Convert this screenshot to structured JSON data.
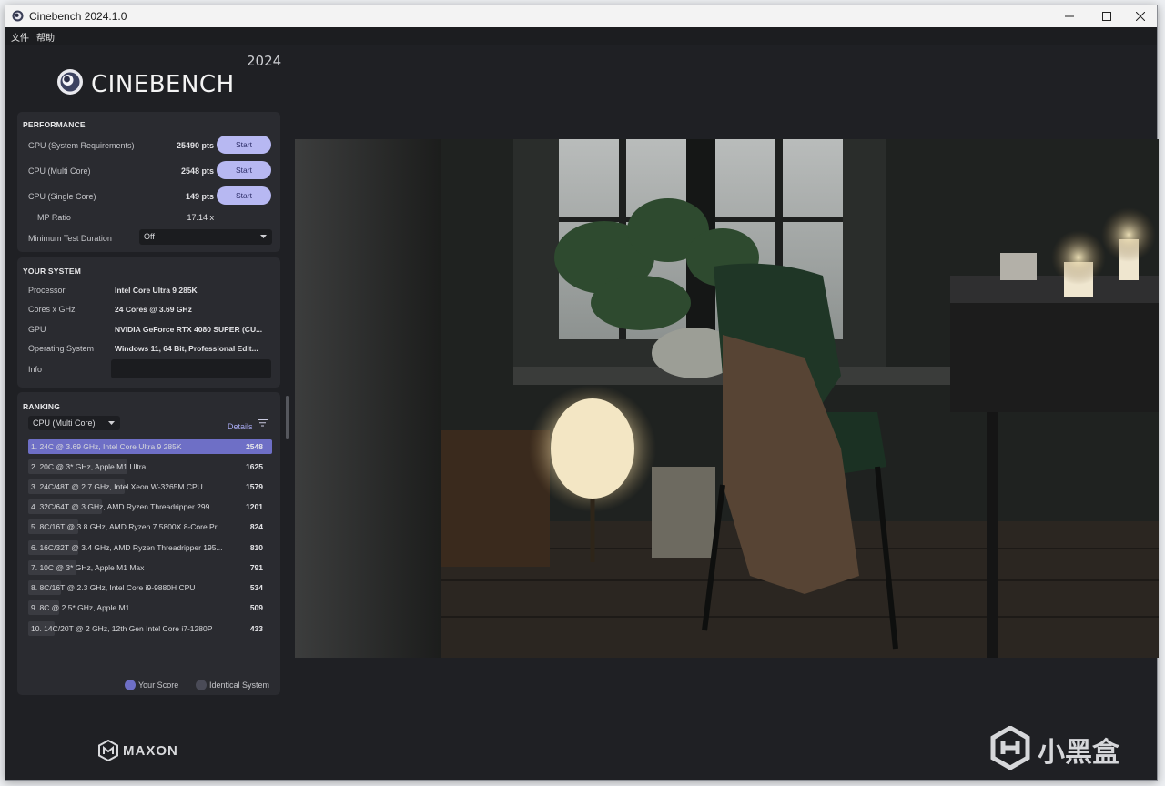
{
  "window": {
    "title": "Cinebench 2024.1.0"
  },
  "menu": [
    "文件",
    "帮助"
  ],
  "brand": {
    "name": "CINEBENCH",
    "year": "2024",
    "footer": "MAXON"
  },
  "performance": {
    "title": "PERFORMANCE",
    "rows": [
      {
        "label": "GPU (System Requirements)",
        "score": "25490 pts",
        "button": "Start"
      },
      {
        "label": "CPU (Multi Core)",
        "score": "2548 pts",
        "button": "Start"
      },
      {
        "label": "CPU (Single Core)",
        "score": "149 pts",
        "button": "Start"
      }
    ],
    "mp_ratio_label": "MP Ratio",
    "mp_ratio_value": "17.14 x",
    "min_duration_label": "Minimum Test Duration",
    "min_duration_value": "Off"
  },
  "system": {
    "title": "YOUR SYSTEM",
    "rows": [
      {
        "label": "Processor",
        "value": "Intel Core Ultra 9 285K"
      },
      {
        "label": "Cores x GHz",
        "value": "24 Cores @ 3.69 GHz"
      },
      {
        "label": "GPU",
        "value": "NVIDIA GeForce RTX 4080 SUPER (CU..."
      },
      {
        "label": "Operating System",
        "value": "Windows 11, 64 Bit, Professional Edit..."
      }
    ],
    "info_label": "Info",
    "info_value": ""
  },
  "ranking": {
    "title": "RANKING",
    "filter": "CPU (Multi Core)",
    "details": "Details",
    "max_score": 2548,
    "rows": [
      {
        "label": "1. 24C @ 3.69 GHz, Intel Core Ultra 9 285K",
        "score": 2548,
        "mine": true
      },
      {
        "label": "2. 20C @ 3* GHz, Apple M1 Ultra",
        "score": 1625,
        "mine": false
      },
      {
        "label": "3. 24C/48T @ 2.7 GHz, Intel Xeon W-3265M CPU",
        "score": 1579,
        "mine": false
      },
      {
        "label": "4. 32C/64T @ 3 GHz, AMD Ryzen Threadripper 299...",
        "score": 1201,
        "mine": false
      },
      {
        "label": "5. 8C/16T @ 3.8 GHz, AMD Ryzen 7 5800X 8-Core Pr...",
        "score": 824,
        "mine": false
      },
      {
        "label": "6. 16C/32T @ 3.4 GHz, AMD Ryzen Threadripper 195...",
        "score": 810,
        "mine": false
      },
      {
        "label": "7. 10C @ 3* GHz, Apple M1 Max",
        "score": 791,
        "mine": false
      },
      {
        "label": "8. 8C/16T @ 2.3 GHz, Intel Core i9-9880H CPU",
        "score": 534,
        "mine": false
      },
      {
        "label": "9. 8C @ 2.5* GHz, Apple M1",
        "score": 509,
        "mine": false
      },
      {
        "label": "10. 14C/20T @ 2 GHz, 12th Gen Intel Core i7-1280P",
        "score": 433,
        "mine": false
      }
    ],
    "legend": {
      "yours": "Your Score",
      "identical": "Identical System"
    }
  },
  "watermark": "小黑盒",
  "colors": {
    "accent": "#b7b8f2",
    "rank_highlight": "#6e6fc6",
    "rank_bar": "#3a3b41",
    "panel": "#2a2b30",
    "background": "#1f2024"
  }
}
